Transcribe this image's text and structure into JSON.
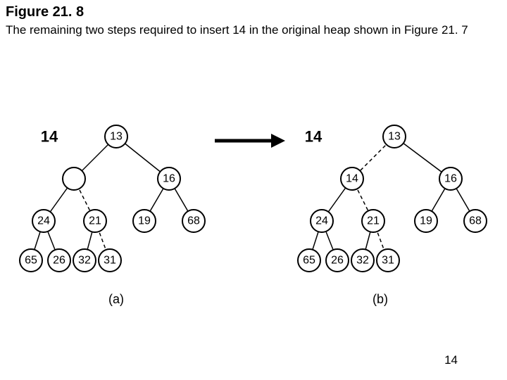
{
  "figure_title": "Figure 21. 8",
  "figure_caption": "The remaining two steps required to insert 14 in the original heap shown in Figure 21. 7",
  "page_number": "14",
  "insert_label_a": "14",
  "insert_label_b": "14",
  "sub_a": "(a)",
  "sub_b": "(b)",
  "heap_a": {
    "root": {
      "value": "13",
      "left": "n2",
      "right": "n3",
      "left_dashed": false,
      "right_dashed": false
    },
    "n2": {
      "value": "",
      "left": "n4",
      "right": "n5",
      "left_dashed": false,
      "right_dashed": true
    },
    "n3": {
      "value": "16",
      "left": "n6",
      "right": "n7",
      "left_dashed": false,
      "right_dashed": false
    },
    "n4": {
      "value": "24",
      "left": "n8",
      "right": "n9",
      "left_dashed": false,
      "right_dashed": false
    },
    "n5": {
      "value": "21",
      "left": "n10",
      "right": "n11",
      "left_dashed": false,
      "right_dashed": true
    },
    "n6": {
      "value": "19"
    },
    "n7": {
      "value": "68"
    },
    "n8": {
      "value": "65"
    },
    "n9": {
      "value": "26"
    },
    "n10": {
      "value": "32"
    },
    "n11": {
      "value": "31"
    }
  },
  "heap_b": {
    "root": {
      "value": "13",
      "left": "n2",
      "right": "n3",
      "left_dashed": true,
      "right_dashed": false
    },
    "n2": {
      "value": "14",
      "left": "n4",
      "right": "n5",
      "left_dashed": false,
      "right_dashed": true
    },
    "n3": {
      "value": "16",
      "left": "n6",
      "right": "n7",
      "left_dashed": false,
      "right_dashed": false
    },
    "n4": {
      "value": "24",
      "left": "n8",
      "right": "n9",
      "left_dashed": false,
      "right_dashed": false
    },
    "n5": {
      "value": "21",
      "left": "n10",
      "right": "n11",
      "left_dashed": false,
      "right_dashed": true
    },
    "n6": {
      "value": "19"
    },
    "n7": {
      "value": "68"
    },
    "n8": {
      "value": "65"
    },
    "n9": {
      "value": "26"
    },
    "n10": {
      "value": "32"
    },
    "n11": {
      "value": "31"
    }
  }
}
